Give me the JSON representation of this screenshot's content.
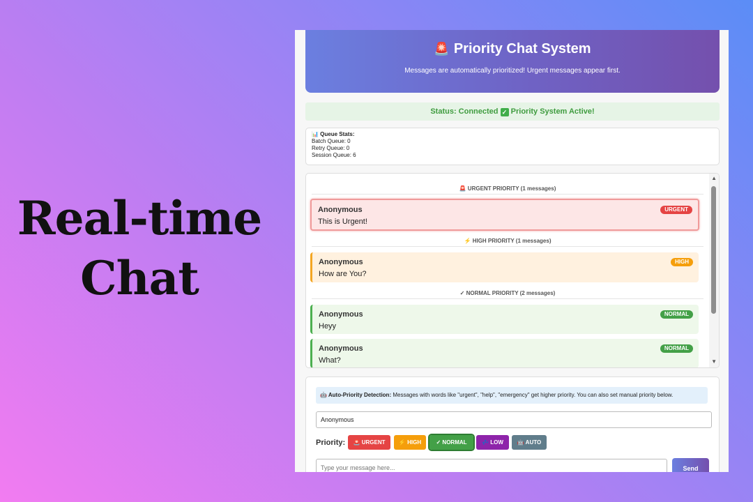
{
  "hero": {
    "line1": "Real-time",
    "line2": "Chat"
  },
  "header": {
    "title": "Priority Chat System",
    "title_icon": "🚨",
    "subtitle": "Messages are automatically prioritized! Urgent messages appear first."
  },
  "status": {
    "prefix": "Status: Connected",
    "check_icon": "✓",
    "suffix": "Priority System Active!"
  },
  "queue_stats": {
    "heading": "📊 Queue Stats:",
    "batch": "Batch Queue: 0",
    "retry": "Retry Queue: 0",
    "session": "Session Queue: 6"
  },
  "groups": {
    "urgent": "🚨 URGENT PRIORITY (1 messages)",
    "high": "⚡ HIGH PRIORITY (1 messages)",
    "normal": "✓ NORMAL PRIORITY (2 messages)"
  },
  "messages": [
    {
      "author": "Anonymous",
      "text": "This is Urgent!",
      "badge": "URGENT"
    },
    {
      "author": "Anonymous",
      "text": "How are You?",
      "badge": "HIGH"
    },
    {
      "author": "Anonymous",
      "text": "Heyy",
      "badge": "NORMAL"
    },
    {
      "author": "Anonymous",
      "text": "What?",
      "badge": "NORMAL"
    }
  ],
  "compose": {
    "info_label": "🤖 Auto-Priority Detection:",
    "info_text": "Messages with words like \"urgent\", \"help\", \"emergency\" get higher priority. You can also set manual priority below.",
    "name_value": "Anonymous",
    "priority_label": "Priority:",
    "buttons": {
      "urgent": "🚨 URGENT",
      "high": "⚡ HIGH",
      "normal": "✓ NORMAL",
      "low": "💤 LOW",
      "auto": "🤖 AUTO"
    },
    "message_placeholder": "Type your message here...",
    "send_label": "Send"
  },
  "colors": {
    "urgent": "#e54444",
    "high": "#f59e0b",
    "normal": "#43a047",
    "low": "#8e24aa",
    "auto": "#607d8b",
    "header_start": "#6b7fe0",
    "header_end": "#7450ad"
  }
}
